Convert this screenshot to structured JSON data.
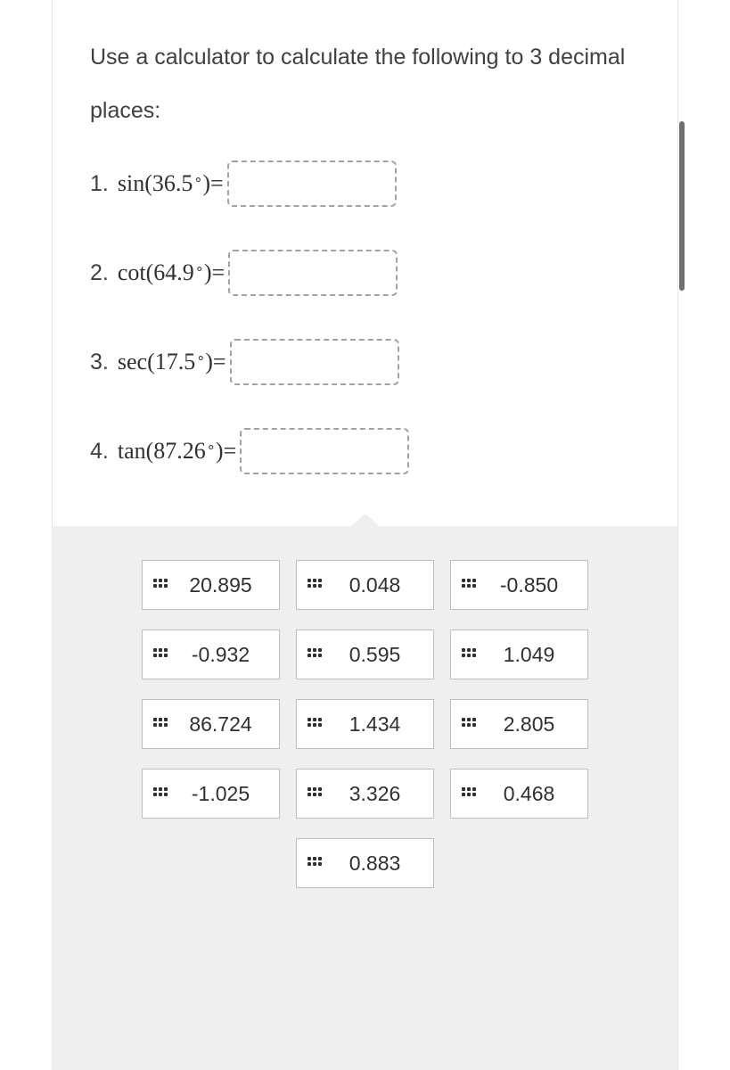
{
  "instructions": "Use a calculator to calculate the following to 3 decimal places:",
  "questions": [
    {
      "num": "1.",
      "func": "sin",
      "arg": "36.5"
    },
    {
      "num": "2.",
      "func": "cot",
      "arg": "64.9"
    },
    {
      "num": "3.",
      "func": "sec",
      "arg": "17.5"
    },
    {
      "num": "4.",
      "func": "tan",
      "arg": "87.26"
    }
  ],
  "bank": [
    "20.895",
    "0.048",
    "-0.850",
    "-0.932",
    "0.595",
    "1.049",
    "86.724",
    "1.434",
    "2.805",
    "-1.025",
    "3.326",
    "0.468",
    "0.883"
  ]
}
